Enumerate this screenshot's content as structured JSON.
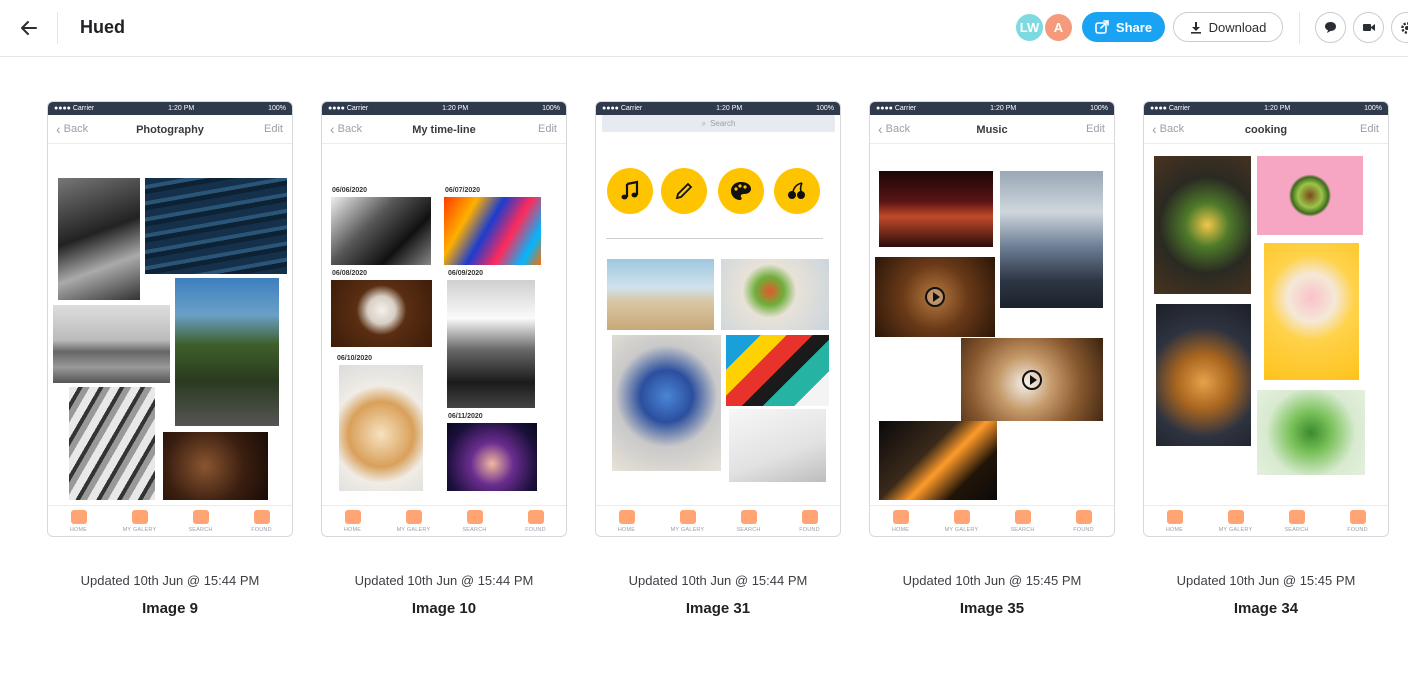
{
  "header": {
    "title": "Hued",
    "avatars": [
      {
        "initials": "LW",
        "color": "#7fd9e0"
      },
      {
        "initials": "A",
        "color": "#f59a7a"
      }
    ],
    "share_label": "Share",
    "download_label": "Download"
  },
  "phone_common": {
    "carrier": "●●●● Carrier",
    "time": "1:20 PM",
    "battery": "100%",
    "back_label": "Back",
    "edit_label": "Edit",
    "tabs": [
      "HOME",
      "MY GALERY",
      "SEARCH",
      "FOUND"
    ],
    "search_placeholder": "Search"
  },
  "cards": [
    {
      "screen_title": "Photography",
      "updated": "Updated 10th Jun @ 15:44 PM",
      "name": "Image 9"
    },
    {
      "screen_title": "My time-line",
      "updated": "Updated 10th Jun @ 15:44 PM",
      "name": "Image 10",
      "dates": [
        "06/06/2020",
        "06/07/2020",
        "06/08/2020",
        "06/09/2020",
        "06/10/2020",
        "06/11/2020"
      ]
    },
    {
      "screen_title": "",
      "updated": "Updated 10th Jun @ 15:44 PM",
      "name": "Image 31"
    },
    {
      "screen_title": "Music",
      "updated": "Updated 10th Jun @ 15:45 PM",
      "name": "Image 35"
    },
    {
      "screen_title": "cooking",
      "updated": "Updated 10th Jun @ 15:45 PM",
      "name": "Image 34"
    }
  ]
}
